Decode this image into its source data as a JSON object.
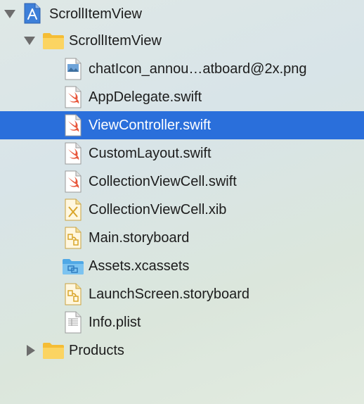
{
  "navigator": {
    "project": {
      "label": "ScrollItemView",
      "icon": "xcode-project-icon",
      "expanded": true
    },
    "group": {
      "label": "ScrollItemView",
      "icon": "folder-icon",
      "expanded": true
    },
    "files": [
      {
        "label": "chatIcon_annou…atboard@2x.png",
        "icon": "png-file-icon",
        "badge": "PNG"
      },
      {
        "label": "AppDelegate.swift",
        "icon": "swift-file-icon",
        "badge": "SWIFT"
      },
      {
        "label": "ViewController.swift",
        "icon": "swift-file-icon",
        "badge": "SWIFT",
        "selected": true
      },
      {
        "label": "CustomLayout.swift",
        "icon": "swift-file-icon",
        "badge": "SWIFT"
      },
      {
        "label": "CollectionViewCell.swift",
        "icon": "swift-file-icon",
        "badge": "SWIFT"
      },
      {
        "label": "CollectionViewCell.xib",
        "icon": "xib-file-icon"
      },
      {
        "label": "Main.storyboard",
        "icon": "storyboard-file-icon"
      },
      {
        "label": "Assets.xcassets",
        "icon": "asset-catalog-icon"
      },
      {
        "label": "LaunchScreen.storyboard",
        "icon": "storyboard-file-icon"
      },
      {
        "label": "Info.plist",
        "icon": "plist-file-icon",
        "badge": "PLIST"
      }
    ],
    "products": {
      "label": "Products",
      "icon": "folder-icon",
      "expanded": false
    }
  },
  "colors": {
    "selection": "#2a6fdb",
    "folder": "#f7c948",
    "swift": "#e8563b",
    "assets": "#5ab0e8"
  }
}
